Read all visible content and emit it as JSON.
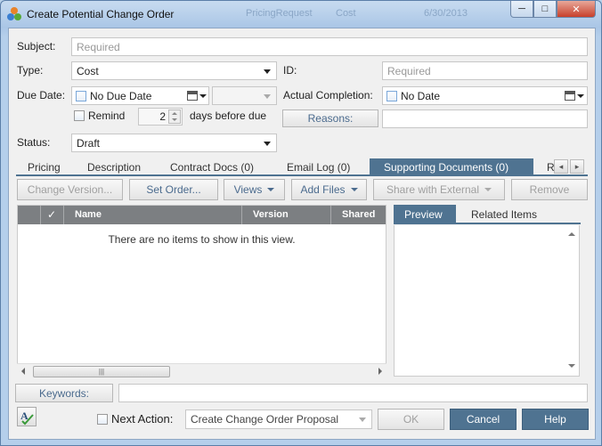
{
  "window": {
    "title": "Create Potential Change Order",
    "ghost_texts": [
      "PricingRequest",
      "Cost",
      "6/30/2013"
    ],
    "controls": {
      "minimize": "─",
      "maximize": "□",
      "close": "✕"
    }
  },
  "form": {
    "subject_label": "Subject:",
    "subject_placeholder": "Required",
    "type_label": "Type:",
    "type_value": "Cost",
    "id_label": "ID:",
    "id_placeholder": "Required",
    "due_date_label": "Due Date:",
    "due_date_value": "No Due Date",
    "actual_completion_label": "Actual Completion:",
    "actual_completion_value": "No Date",
    "remind_label": "Remind",
    "remind_days": "2",
    "days_before_label": "days before due",
    "reasons_label": "Reasons:",
    "status_label": "Status:",
    "status_value": "Draft"
  },
  "tabs": [
    {
      "label": "Pricing"
    },
    {
      "label": "Description"
    },
    {
      "label": "Contract Docs (0)"
    },
    {
      "label": "Email Log (0)"
    },
    {
      "label": "Supporting Documents (0)",
      "active": true
    },
    {
      "label": "R"
    }
  ],
  "toolbar": {
    "change_version": "Change Version...",
    "set_order": "Set Order...",
    "views": "Views",
    "add_files": "Add Files",
    "share_external": "Share with External",
    "remove": "Remove"
  },
  "grid": {
    "check_header": "✓",
    "columns": [
      "Name",
      "Version",
      "Shared"
    ],
    "empty_message": "There are no items to show in this view.",
    "scroll_thumb_grip": "|||"
  },
  "preview": {
    "tabs": [
      "Preview",
      "Related Items"
    ]
  },
  "footer": {
    "keywords_label": "Keywords:",
    "next_action_label": "Next Action:",
    "next_action_value": "Create Change Order Proposal",
    "ok": "OK",
    "cancel": "Cancel",
    "help": "Help"
  },
  "colors": {
    "accent": "#4f7391",
    "title_bar": "#b9d1ea",
    "close_button": "#c7402b",
    "grid_header": "#7c7f82"
  },
  "icons": [
    "app-logo-icon",
    "calendar-icon",
    "spell-check-icon",
    "chevron-down-icon"
  ]
}
